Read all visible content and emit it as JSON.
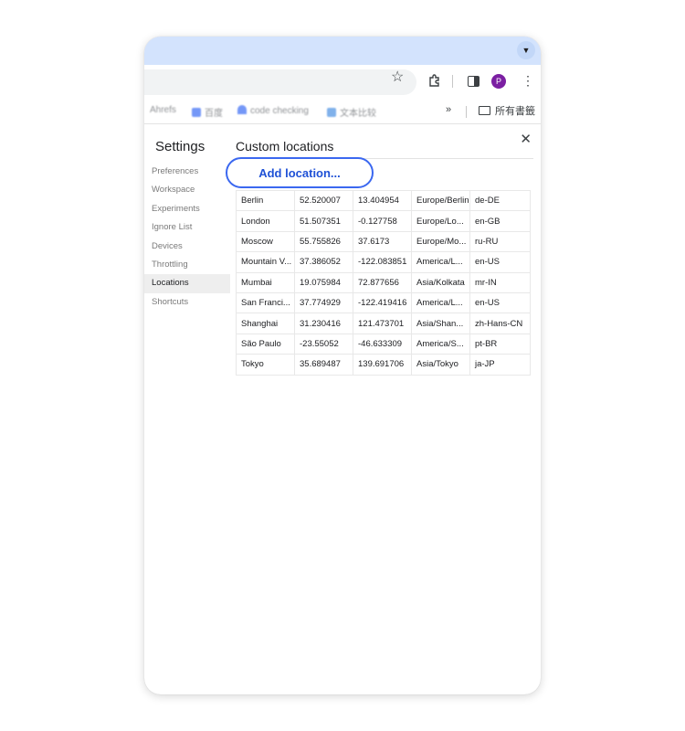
{
  "browser": {
    "avatar_letter": "P",
    "tab_menu_icon": "chevron-down-icon",
    "bookmarks": [
      {
        "label": "Ahrefs",
        "icon_color": "#9aa0a6"
      },
      {
        "label": "百度",
        "icon_color": "#3a6cf4"
      },
      {
        "label": "code checking",
        "icon_color": "#3a6cf4"
      },
      {
        "label": "文本比较",
        "icon_color": "#4a90e2"
      }
    ],
    "more_label": "»",
    "folder_label": "所有書籤"
  },
  "settings": {
    "title": "Settings",
    "nav": [
      "Preferences",
      "Workspace",
      "Experiments",
      "Ignore List",
      "Devices",
      "Throttling",
      "Locations",
      "Shortcuts"
    ],
    "active_nav": "Locations"
  },
  "locations": {
    "title": "Custom locations",
    "add_button": "Add location...",
    "rows": [
      [
        "Berlin",
        "52.520007",
        "13.404954",
        "Europe/Berlin",
        "de-DE"
      ],
      [
        "London",
        "51.507351",
        "-0.127758",
        "Europe/Lo...",
        "en-GB"
      ],
      [
        "Moscow",
        "55.755826",
        "37.6173",
        "Europe/Mo...",
        "ru-RU"
      ],
      [
        "Mountain V...",
        "37.386052",
        "-122.083851",
        "America/L...",
        "en-US"
      ],
      [
        "Mumbai",
        "19.075984",
        "72.877656",
        "Asia/Kolkata",
        "mr-IN"
      ],
      [
        "San Franci...",
        "37.774929",
        "-122.419416",
        "America/L...",
        "en-US"
      ],
      [
        "Shanghai",
        "31.230416",
        "121.473701",
        "Asia/Shan...",
        "zh-Hans-CN"
      ],
      [
        "São Paulo",
        "-23.55052",
        "-46.633309",
        "America/S...",
        "pt-BR"
      ],
      [
        "Tokyo",
        "35.689487",
        "139.691706",
        "Asia/Tokyo",
        "ja-JP"
      ]
    ]
  },
  "colors": {
    "accent": "#3b68f0",
    "titlebar": "#d3e3fd",
    "avatar": "#7b1fa2"
  }
}
